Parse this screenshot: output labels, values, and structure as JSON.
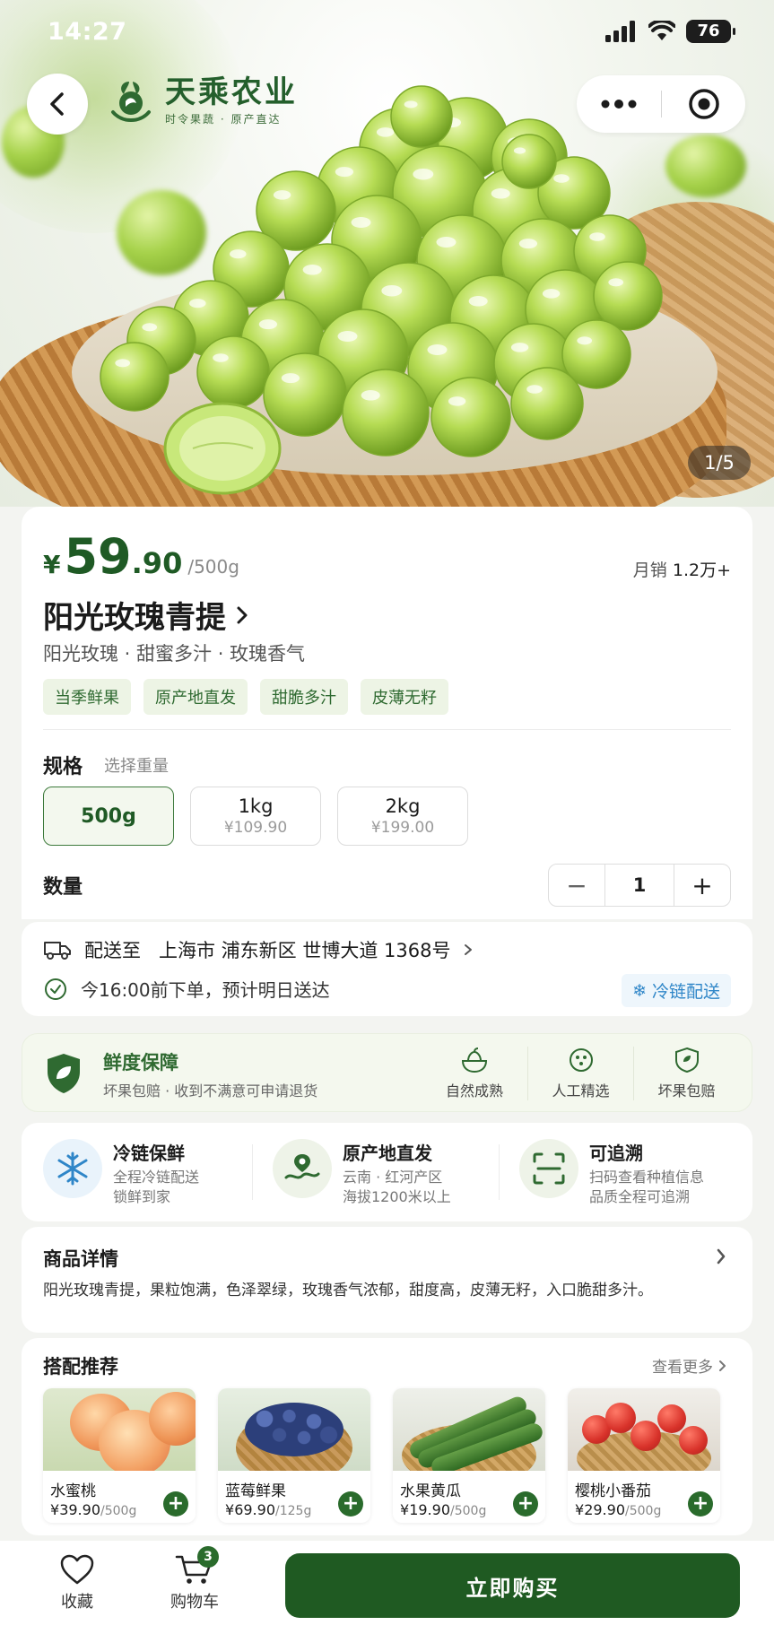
{
  "status_bar": {
    "time": "14:27",
    "battery": "76"
  },
  "brand": {
    "name": "天乘农业",
    "tagline": "时令果蔬 · 原产直达"
  },
  "gallery": {
    "counter": "1/5"
  },
  "product": {
    "currency": "¥",
    "price_int": "59",
    "price_dec": ".90",
    "price_unit": "/500g",
    "sales_label": "月销",
    "sales_value": "1.2万+",
    "title": "阳光玫瑰青提",
    "subtitle": "阳光玫瑰 · 甜蜜多汁 · 玫瑰香气",
    "tags": [
      "当季鲜果",
      "原产地直发",
      "甜脆多汁",
      "皮薄无籽"
    ]
  },
  "spec": {
    "label": "规格",
    "hint": "选择重量",
    "options": [
      {
        "weight": "500g",
        "price": "",
        "selected": true
      },
      {
        "weight": "1kg",
        "price": "¥109.90",
        "selected": false
      },
      {
        "weight": "2kg",
        "price": "¥199.00",
        "selected": false
      }
    ]
  },
  "quantity": {
    "label": "数量",
    "minus": "−",
    "value": "1",
    "plus": "+"
  },
  "shipping": {
    "label": "配送至",
    "address": "上海市 浦东新区 世博大道 1368号",
    "eta": "今16:00前下单，预计明日送达",
    "cold_chain": "冷链配送"
  },
  "guarantee": {
    "title": "鲜度保障",
    "subtitle": "坏果包赔 · 收到不满意可申请退货",
    "items": [
      {
        "icon": "ripe-icon",
        "label": "自然成熟"
      },
      {
        "icon": "hand-pick-icon",
        "label": "人工精选"
      },
      {
        "icon": "shield-leaf-icon",
        "label": "坏果包赔"
      }
    ]
  },
  "features": [
    {
      "icon": "snowflake-icon",
      "title": "冷链保鲜",
      "line1": "全程冷链配送",
      "line2": "锁鲜到家"
    },
    {
      "icon": "map-pin-icon",
      "title": "原产地直发",
      "line1": "云南 · 红河产区",
      "line2": "海拔1200米以上"
    },
    {
      "icon": "scan-icon",
      "title": "可追溯",
      "line1": "扫码查看种植信息",
      "line2": "品质全程可追溯"
    }
  ],
  "detail": {
    "title": "商品详情",
    "text": "阳光玫瑰青提，果粒饱满，色泽翠绿，玫瑰香气浓郁，甜度高，皮薄无籽，入口脆甜多汁。"
  },
  "recommend": {
    "title": "搭配推荐",
    "more": "查看更多",
    "items": [
      {
        "name": "水蜜桃",
        "currency": "¥",
        "price": "39.90",
        "unit": "/500g",
        "color": "#f2a36a"
      },
      {
        "name": "蓝莓鲜果",
        "currency": "¥",
        "price": "69.90",
        "unit": "/125g",
        "color": "#2c3f7a"
      },
      {
        "name": "水果黄瓜",
        "currency": "¥",
        "price": "19.90",
        "unit": "/500g",
        "color": "#3f7d2c"
      },
      {
        "name": "樱桃小番茄",
        "currency": "¥",
        "price": "29.90",
        "unit": "/500g",
        "color": "#d8322a"
      }
    ]
  },
  "bottom_bar": {
    "favorite": "收藏",
    "cart": "购物车",
    "cart_count": "3",
    "buy": "立即购买"
  },
  "colors": {
    "brand_green": "#1f5a22",
    "accent_blue": "#2f86c8",
    "tag_bg": "#edf4e5"
  }
}
